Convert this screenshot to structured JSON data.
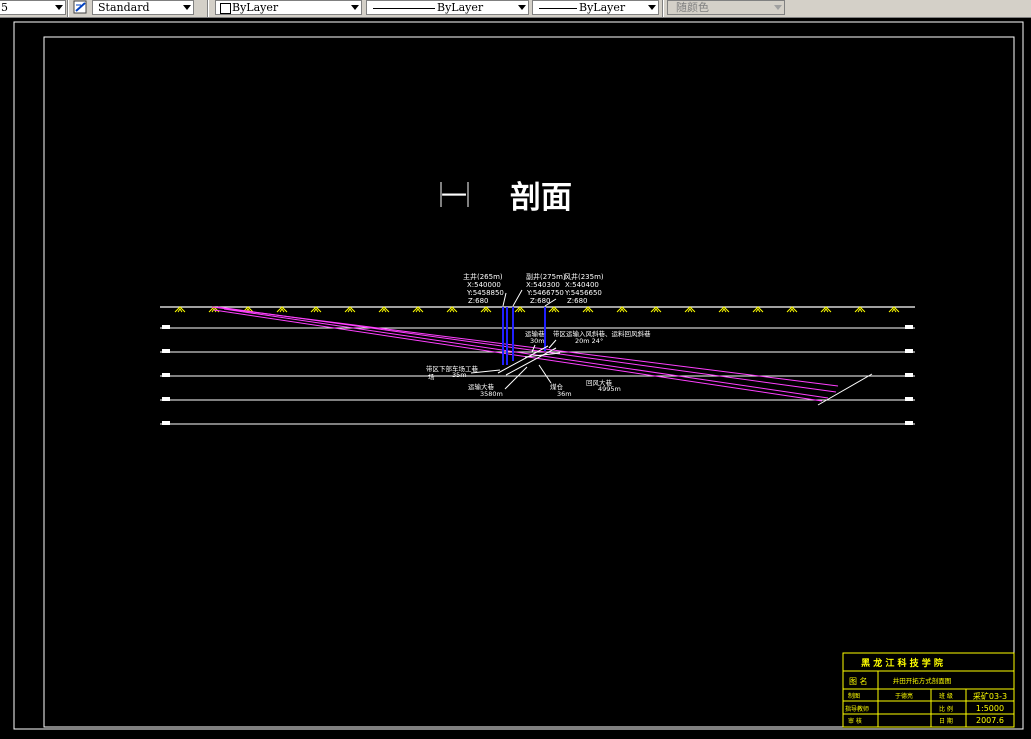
{
  "toolbar": {
    "field_left_value": "5",
    "text_style_value": "Standard",
    "layer_value": "ByLayer",
    "linetype_value": "ByLayer",
    "lineweight_value": "ByLayer",
    "color_value": "随颜色"
  },
  "drawing": {
    "title_roman": "一",
    "title_word": "剖面",
    "shafts": [
      {
        "name": "主井(265m)",
        "x": "X:540000",
        "y": "Y:5458850",
        "z": "Z:680"
      },
      {
        "name": "副井(275m)",
        "x": "X:540300",
        "y": "Y:5466750",
        "z": "Z:680"
      },
      {
        "name": "风井(235m)",
        "x": "X:540400",
        "y": "Y:5456650",
        "z": "Z:680"
      }
    ],
    "labels": {
      "roadway_a": "运输巷",
      "roadway_a_len": "30m",
      "roadway_b": "带区运输入风斜巷、运料回风斜巷",
      "roadway_b_len": "20m 24°",
      "roadway_c": "带区下部车场工巷",
      "roadway_c_sub": "场",
      "roadway_c_len": "35m",
      "roadway_d": "运输大巷",
      "roadway_d_len": "3580m",
      "roadway_e": "煤仓",
      "roadway_e_len": "36m",
      "roadway_f": "回风大巷",
      "roadway_f_len": "4995m"
    },
    "title_block": {
      "school": "黑 龙 江 科 技 学 院",
      "name_label": "图  名",
      "drawing_name": "井田开拓方式剖面图",
      "row1_label": "制图",
      "row1_value": "于德亮",
      "row1_key": "班 级",
      "row1_key_value": "采矿03-3",
      "row2_label": "指导教师",
      "row2_value": "",
      "row2_key": "比 例",
      "row2_key_value": "1:5000",
      "row3_label": "审 核",
      "row3_value": "",
      "row3_key": "日 期",
      "row3_key_value": "2007.6"
    },
    "colors": {
      "background": "#000000",
      "lines": "#ffffff",
      "coal_seams": "#ff40ff",
      "shafts": "#2020ff",
      "hatch": "#ffff00",
      "title_block": "#ffff00"
    }
  }
}
